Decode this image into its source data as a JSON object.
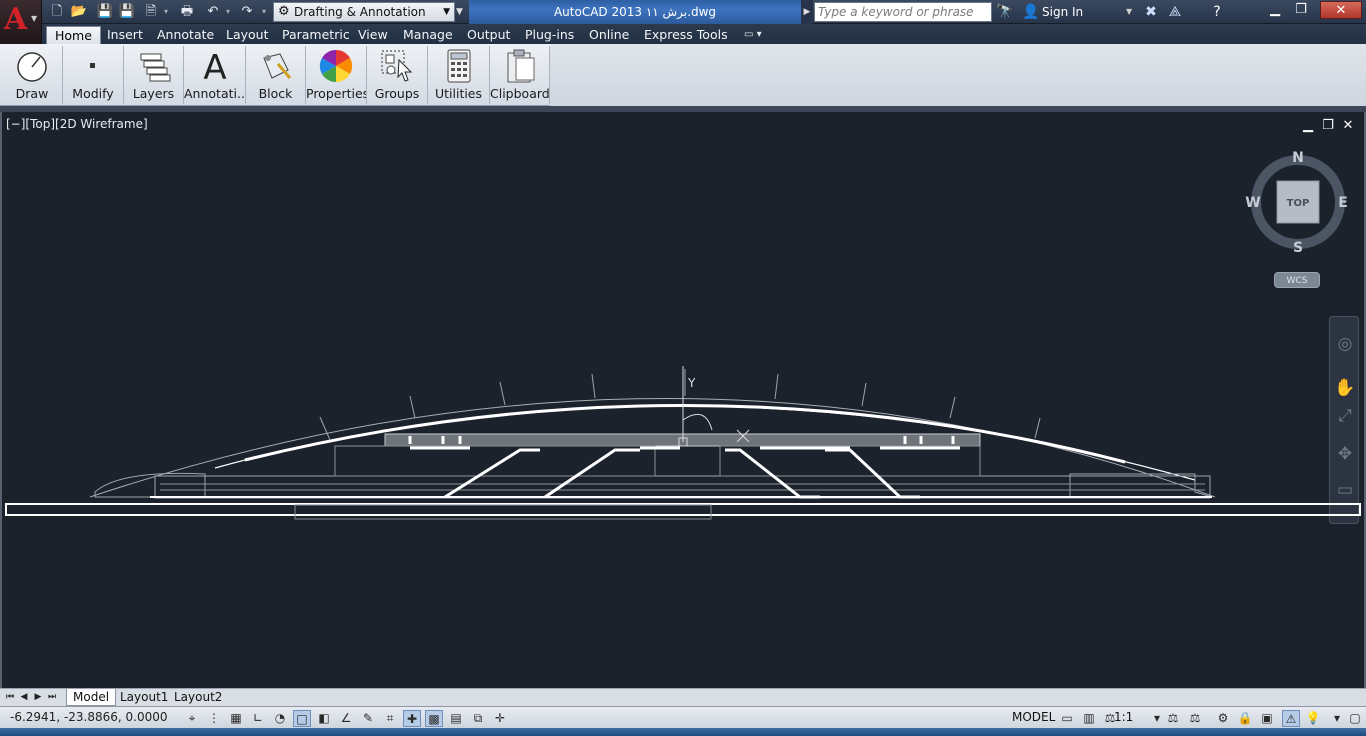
{
  "titlebar": {
    "workspace": "Drafting & Annotation",
    "window_title": "AutoCAD 2013    برش ١١.dwg",
    "search_placeholder": "Type a keyword or phrase",
    "signin_label": "Sign In"
  },
  "ribbon": {
    "tabs": [
      {
        "label": "Home"
      },
      {
        "label": "Insert"
      },
      {
        "label": "Annotate"
      },
      {
        "label": "Layout"
      },
      {
        "label": "Parametric"
      },
      {
        "label": "View"
      },
      {
        "label": "Manage"
      },
      {
        "label": "Output"
      },
      {
        "label": "Plug-ins"
      },
      {
        "label": "Online"
      },
      {
        "label": "Express Tools"
      }
    ],
    "panels": [
      {
        "label": "Draw"
      },
      {
        "label": "Modify"
      },
      {
        "label": "Layers"
      },
      {
        "label": "Annotati..."
      },
      {
        "label": "Block"
      },
      {
        "label": "Properties"
      },
      {
        "label": "Groups"
      },
      {
        "label": "Utilities"
      },
      {
        "label": "Clipboard"
      }
    ]
  },
  "viewport": {
    "controls": "[−][Top][2D Wireframe]",
    "viewcube": {
      "n": "N",
      "s": "S",
      "e": "E",
      "w": "W",
      "face": "TOP"
    },
    "wcs": "WCS"
  },
  "layout_tabs": [
    {
      "label": "Model"
    },
    {
      "label": "Layout1"
    },
    {
      "label": "Layout2"
    }
  ],
  "status": {
    "coords": "-6.2941, -23.8866, 0.0000",
    "space": "MODEL",
    "scale": "1:1"
  },
  "colors": {
    "canvas": "#1b222c",
    "title_accent": "#3e74c0",
    "logo_red": "#d12328"
  }
}
